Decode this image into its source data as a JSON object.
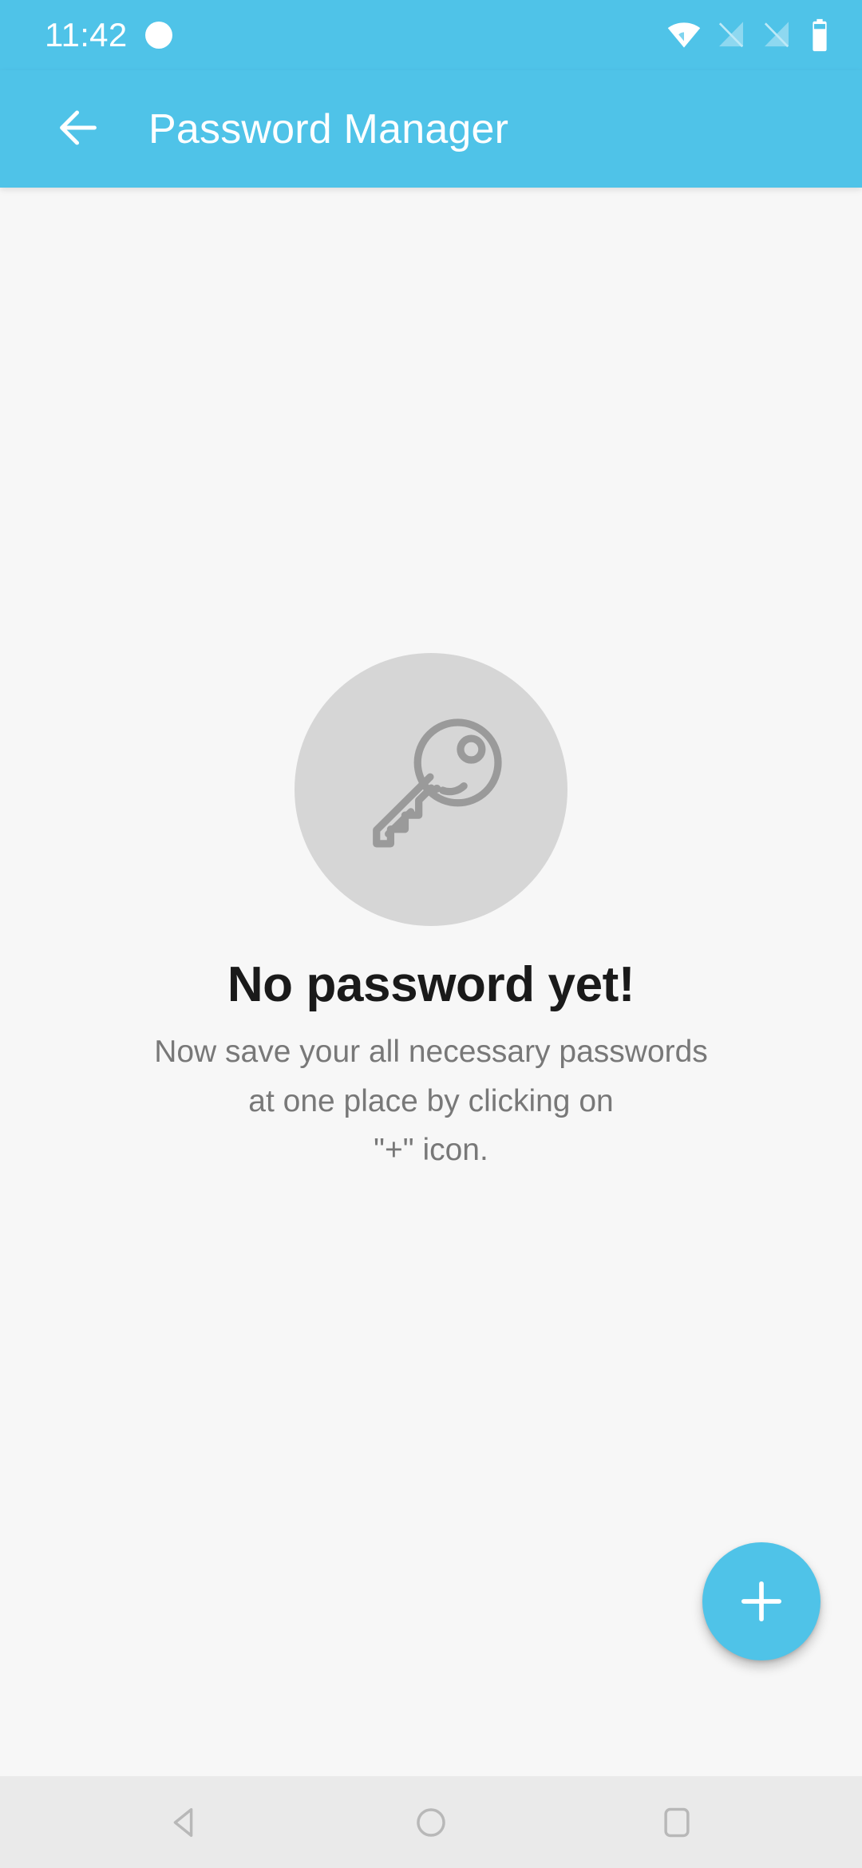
{
  "status_bar": {
    "time": "11:42",
    "notification_dot": "notification-dot",
    "icons": [
      "wifi-full-icon",
      "no-signal-sim1-icon",
      "no-signal-sim2-icon",
      "battery-icon"
    ]
  },
  "app_bar": {
    "back_label": "back-arrow",
    "title": "Password Manager"
  },
  "empty_state": {
    "illustration": "key-icon",
    "title": "No password yet!",
    "subtitle_lines": [
      "Now save your all necessary passwords",
      "at one place by clicking on",
      "\"+\" icon."
    ]
  },
  "fab": {
    "label": "add-password",
    "icon": "plus-icon"
  },
  "nav_bar": {
    "back": "back-triangle-icon",
    "home": "home-circle-icon",
    "recents": "recents-square-icon"
  },
  "colors": {
    "accent": "#4FC3E8",
    "background": "#F7F7F7",
    "nav_background": "#EAEAEA",
    "illustration_circle": "#D6D6D6",
    "illustration_stroke": "#9A9A9A",
    "title_text": "#1A1A1A",
    "subtitle_text": "#787878",
    "on_accent": "#FFFFFF"
  }
}
